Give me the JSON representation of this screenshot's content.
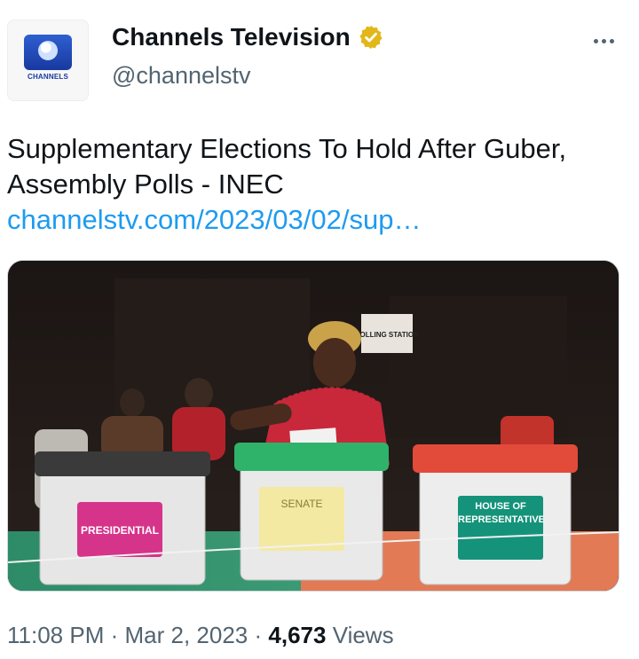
{
  "author": {
    "display_name": "Channels Television",
    "handle": "@channelstv",
    "verified_badge": "gold-verified-icon",
    "avatar_text": "CHANNELS"
  },
  "tweet": {
    "text": "Supplementary Elections To Hold After Guber, Assembly Polls - INEC",
    "link": "channelstv.com/2023/03/02/sup…"
  },
  "media": {
    "ballot_labels": [
      "PRESIDENTIAL",
      "SENATE",
      "HOUSE OF REPRESENTATIVES"
    ],
    "sign_text": "POLLING STATION",
    "box_lid_colors": [
      "#3a3a3a",
      "#2fb36a",
      "#e24b3a"
    ],
    "label_colors": [
      "#d6338a",
      "#f4e9a2",
      "#14937a"
    ]
  },
  "footer": {
    "time": "11:08 PM",
    "separator": "·",
    "date": "Mar 2, 2023",
    "views_count": "4,673",
    "views_label": "Views"
  },
  "colors": {
    "link": "#1d9bf0",
    "secondary_text": "#536471",
    "primary_text": "#0f1419",
    "verified_gold": "#e2b719"
  },
  "icons": {
    "more": "more-horizontal-icon"
  }
}
